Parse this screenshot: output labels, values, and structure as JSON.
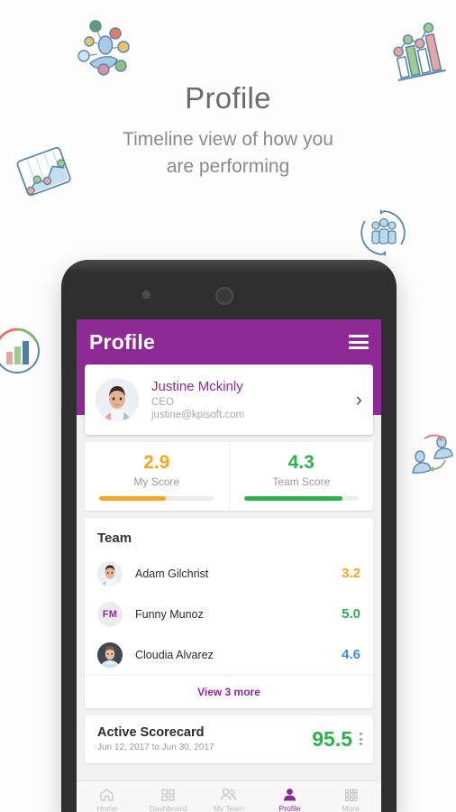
{
  "page": {
    "title": "Profile",
    "subtitle": "Timeline view of how you\nare performing"
  },
  "colors": {
    "brand_purple": "#8E2A96",
    "orange": "#F5A623",
    "green": "#2BB24C",
    "blue": "#3D8BE0",
    "muted": "#9a9a9a"
  },
  "decorations": [
    {
      "name": "network-nodes-icon",
      "label": "network-nodes-icon"
    },
    {
      "name": "bar-chart-tilted-icon",
      "label": "bar-chart-tilted-icon"
    },
    {
      "name": "line-chart-card-icon",
      "label": "line-chart-card-icon"
    },
    {
      "name": "people-cycle-icon",
      "label": "people-cycle-icon"
    },
    {
      "name": "circular-bar-chart-icon",
      "label": "circular-bar-chart-icon"
    },
    {
      "name": "people-exchange-icon",
      "label": "people-exchange-icon"
    }
  ],
  "app": {
    "appbar": {
      "title": "Profile",
      "menu_icon": "hamburger-menu-icon"
    },
    "profile": {
      "name": "Justine Mckinly",
      "role": "CEO",
      "email": "justine@kpisoft.com",
      "chevron": "›",
      "avatar_icon": "user-photo-avatar"
    },
    "scores": [
      {
        "value": "2.9",
        "label": "My Score",
        "color": "#F5A623",
        "percent": 58
      },
      {
        "value": "4.3",
        "label": "Team Score",
        "color": "#2BB24C",
        "percent": 86
      }
    ],
    "team": {
      "heading": "Team",
      "members": [
        {
          "name": "Adam Gilchrist",
          "score": "3.2",
          "color": "#F5A623",
          "avatar_type": "photo",
          "initials": ""
        },
        {
          "name": "Funny Munoz",
          "score": "5.0",
          "color": "#2BB24C",
          "avatar_type": "initials",
          "initials": "FM"
        },
        {
          "name": "Cloudia Alvarez",
          "score": "4.6",
          "color": "#3D8BE0",
          "avatar_type": "photo",
          "initials": ""
        }
      ],
      "view_more": "View 3 more"
    },
    "scorecard": {
      "title": "Active Scorecard",
      "date_range": "Jun 12, 2017 to Jun 30, 2017",
      "value": "95.5",
      "menu_icon": "kebab-menu-icon"
    },
    "bottom_nav": [
      {
        "label": "Home",
        "icon": "home-icon",
        "active": false
      },
      {
        "label": "Dashboard",
        "icon": "dashboard-grid-icon",
        "active": false
      },
      {
        "label": "My Team",
        "icon": "people-icon",
        "active": false
      },
      {
        "label": "Profile",
        "icon": "person-icon",
        "active": true
      },
      {
        "label": "More",
        "icon": "more-grid-icon",
        "active": false
      }
    ]
  }
}
